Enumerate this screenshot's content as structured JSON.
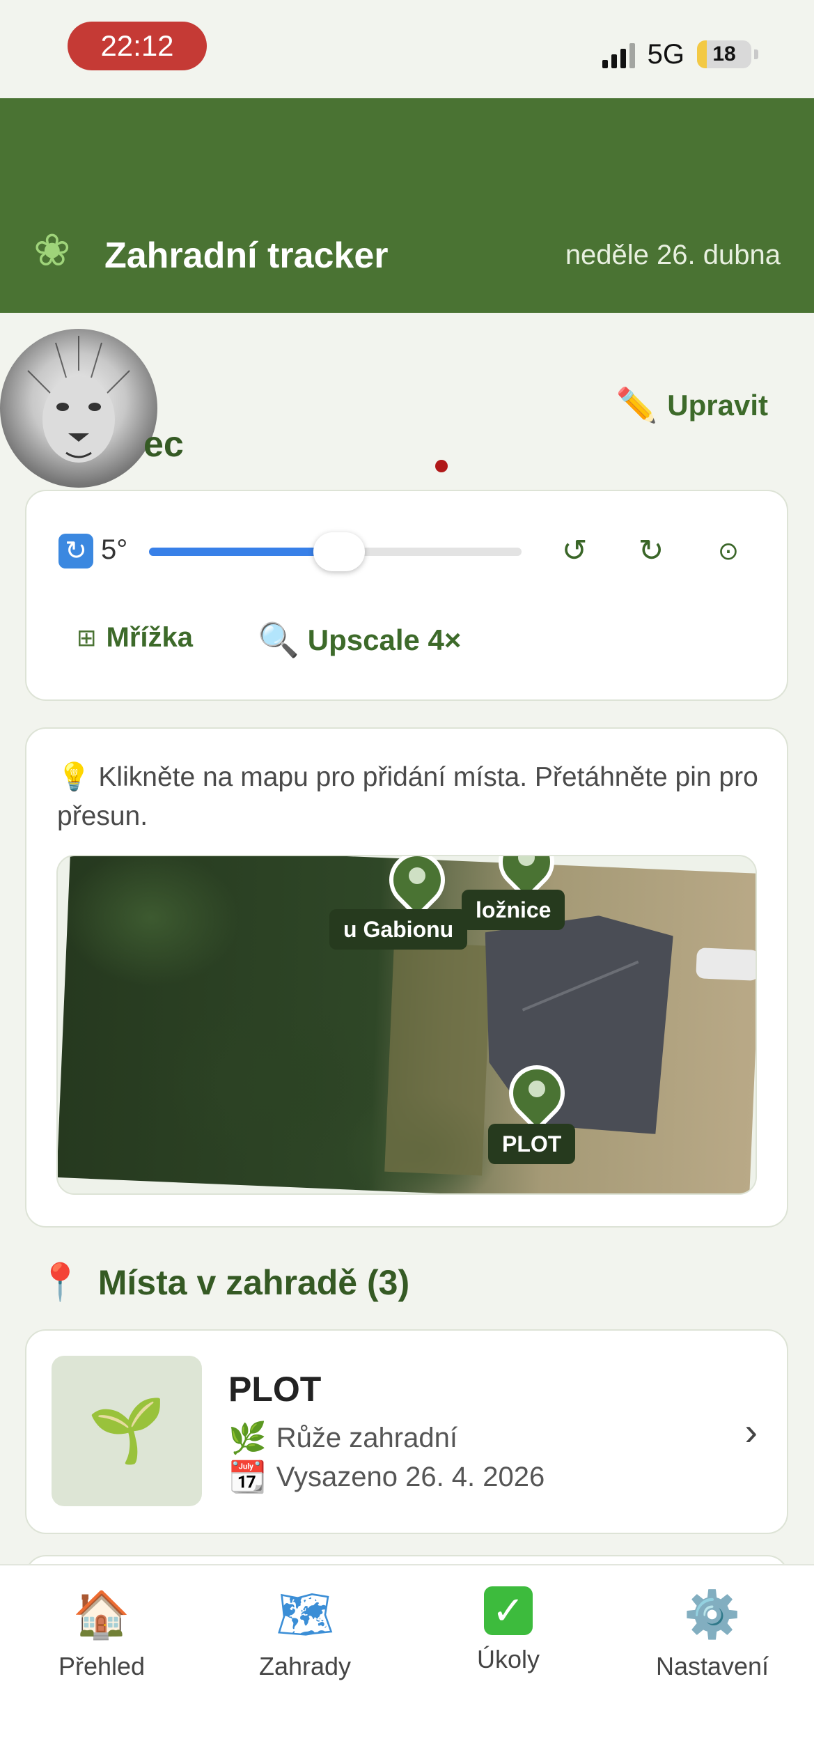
{
  "status_bar": {
    "time": "22:12",
    "network": "5G",
    "battery_level": "18",
    "battery_fraction": 0.18
  },
  "header": {
    "icon": "herb-icon",
    "title": "Zahradní tracker",
    "date": "neděle 26. dubna"
  },
  "garden": {
    "name_visible": "ec",
    "edit_label": "Upravit",
    "edit_icon": "pencil-icon"
  },
  "controls": {
    "rotation_icon": "rotate-arrows-icon",
    "rotation_value": "5°",
    "rotation_fraction": 0.51,
    "grid_label": "Mřížka",
    "upscale_label": "Upscale 4×"
  },
  "map": {
    "hint_icon": "lightbulb-icon",
    "hint": "Klikněte na mapu pro přidání místa. Přetáhněte pin pro přesun.",
    "pins": [
      {
        "label": "u Gabionu"
      },
      {
        "label": "ložnice"
      },
      {
        "label": "PLOT"
      }
    ]
  },
  "places": {
    "heading": "Místa v zahradě (3)",
    "heading_icon": "map-pin-icon",
    "items": [
      {
        "name": "PLOT",
        "thumb_icon": "seedling-icon",
        "plant": "Růže zahradní",
        "planted": "Vysazeno 26. 4. 2026"
      }
    ]
  },
  "tabs": [
    {
      "label": "Přehled",
      "icon": "house-icon"
    },
    {
      "label": "Zahrady",
      "icon": "map-icon"
    },
    {
      "label": "Úkoly",
      "icon": "checkbox-icon"
    },
    {
      "label": "Nastavení",
      "icon": "gear-icon"
    }
  ],
  "colors": {
    "primary": "#4a7333",
    "accent_blue": "#3880e8",
    "time_pill": "#c53a35"
  }
}
